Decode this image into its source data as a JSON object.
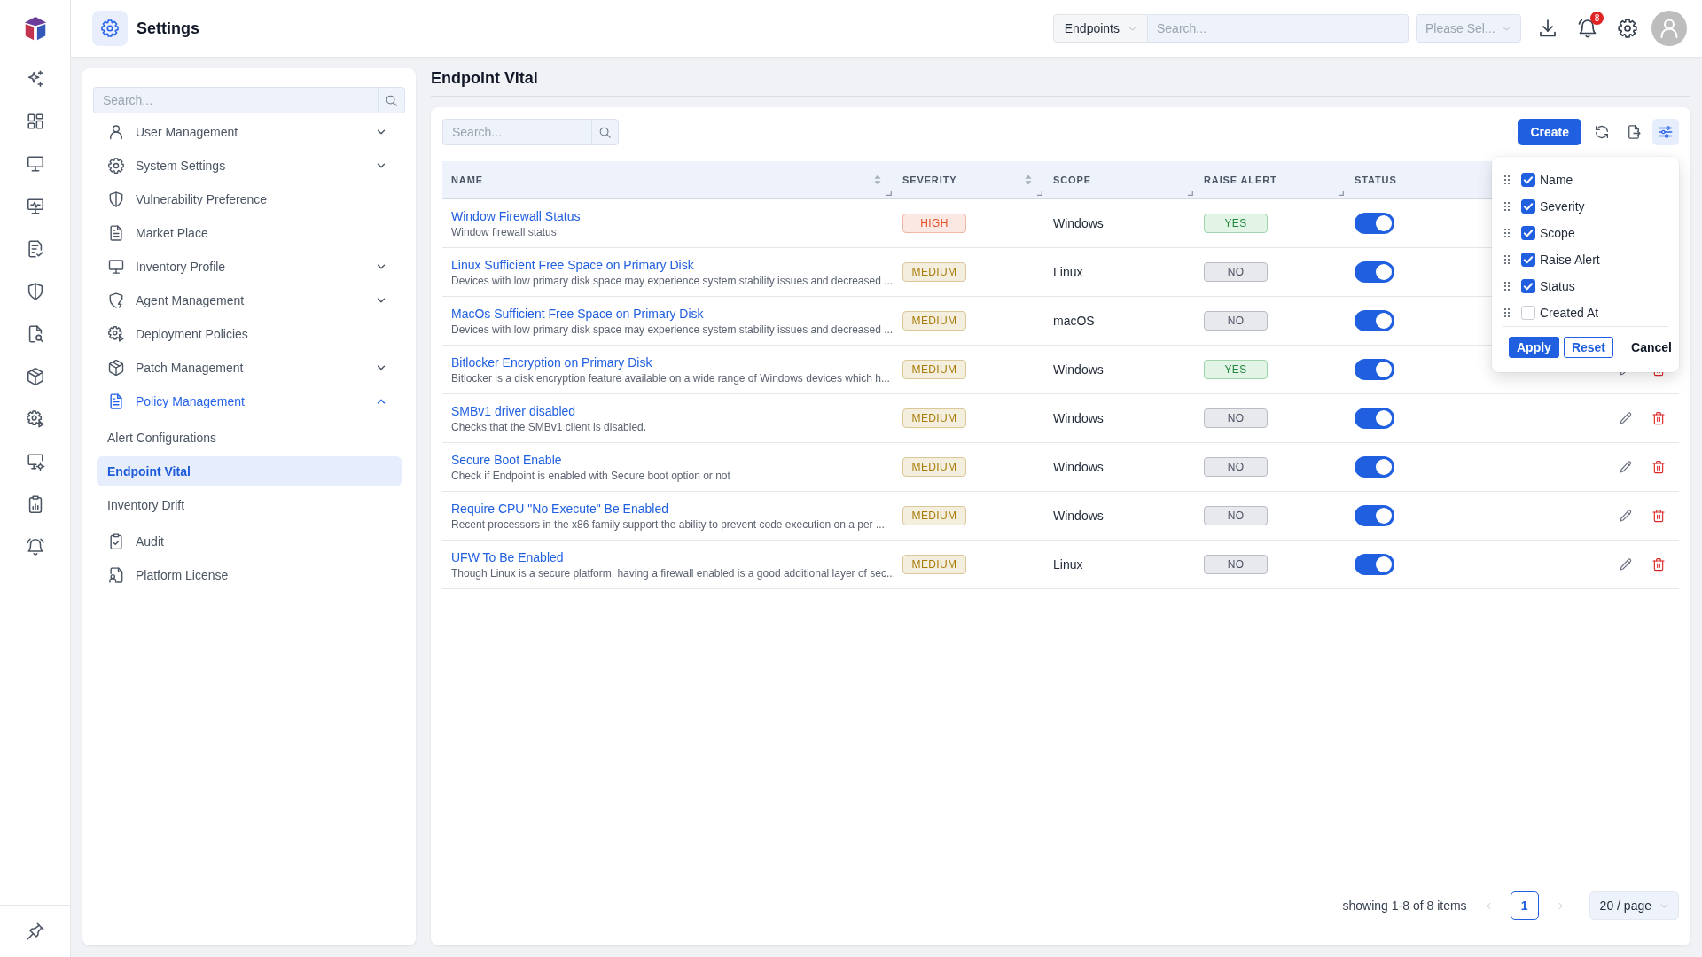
{
  "topbar": {
    "title": "Settings",
    "scope_select": {
      "value": "Endpoints"
    },
    "search": {
      "placeholder": "Search..."
    },
    "filter_select": {
      "placeholder": "Please Sel..."
    },
    "notification_count": "8"
  },
  "sidebar": {
    "search": {
      "placeholder": "Search..."
    },
    "items": [
      {
        "label": "User Management",
        "kind": "group",
        "expanded": false,
        "selected": false
      },
      {
        "label": "System Settings",
        "kind": "group",
        "expanded": false,
        "selected": false
      },
      {
        "label": "Vulnerability Preference",
        "kind": "link",
        "selected": false
      },
      {
        "label": "Market Place",
        "kind": "link",
        "selected": false
      },
      {
        "label": "Inventory Profile",
        "kind": "group",
        "expanded": false,
        "selected": false
      },
      {
        "label": "Agent Management",
        "kind": "group",
        "expanded": false,
        "selected": false
      },
      {
        "label": "Deployment Policies",
        "kind": "link",
        "selected": false
      },
      {
        "label": "Patch Management",
        "kind": "group",
        "expanded": false,
        "selected": false
      },
      {
        "label": "Policy Management",
        "kind": "group",
        "expanded": true,
        "selected": false,
        "children": [
          {
            "label": "Alert Configurations",
            "selected": false
          },
          {
            "label": "Endpoint Vital",
            "selected": true
          },
          {
            "label": "Inventory Drift",
            "selected": false
          }
        ]
      },
      {
        "label": "Audit",
        "kind": "link",
        "selected": false
      },
      {
        "label": "Platform License",
        "kind": "link",
        "selected": false
      }
    ]
  },
  "page": {
    "title": "Endpoint Vital",
    "toolbar": {
      "search": {
        "placeholder": "Search..."
      },
      "create_button": "Create",
      "column_menu": {
        "open": true,
        "items": [
          {
            "label": "Name",
            "checked": true
          },
          {
            "label": "Severity",
            "checked": true
          },
          {
            "label": "Scope",
            "checked": true
          },
          {
            "label": "Raise Alert",
            "checked": true
          },
          {
            "label": "Status",
            "checked": true
          },
          {
            "label": "Created At",
            "checked": false
          }
        ],
        "buttons": [
          {
            "label": "Apply",
            "kind": "primary"
          },
          {
            "label": "Reset",
            "kind": "outline"
          },
          {
            "label": "Cancel",
            "kind": "text"
          }
        ]
      }
    },
    "table": {
      "columns": [
        {
          "label": "NAME",
          "sortable": true,
          "resizable": true
        },
        {
          "label": "SEVERITY",
          "sortable": true,
          "resizable": true
        },
        {
          "label": "SCOPE",
          "sortable": false,
          "resizable": true
        },
        {
          "label": "RAISE ALERT",
          "sortable": false,
          "resizable": true
        },
        {
          "label": "STATUS",
          "sortable": false,
          "resizable": false
        }
      ],
      "rows": [
        {
          "name": "Window Firewall Status",
          "description": "Window firewall status",
          "severity": {
            "label": "HIGH",
            "color": "#e0512b"
          },
          "scope": "Windows",
          "raise_alert": {
            "label": "YES",
            "on": true
          },
          "enabled": true
        },
        {
          "name": "Linux Sufficient Free Space on Primary Disk",
          "description": "Devices with low primary disk space may experience system stability issues and decreased ...",
          "severity": {
            "label": "MEDIUM",
            "color": "#a87b06"
          },
          "scope": "Linux",
          "raise_alert": {
            "label": "NO",
            "on": false
          },
          "enabled": true
        },
        {
          "name": "MacOs Sufficient Free Space on Primary Disk",
          "description": "Devices with low primary disk space may experience system stability issues and decreased ...",
          "severity": {
            "label": "MEDIUM",
            "color": "#a87b06"
          },
          "scope": "macOS",
          "raise_alert": {
            "label": "NO",
            "on": false
          },
          "enabled": true
        },
        {
          "name": "Bitlocker Encryption on Primary Disk",
          "description": "Bitlocker is a disk encryption feature available on a wide range of Windows devices which h...",
          "severity": {
            "label": "MEDIUM",
            "color": "#a87b06"
          },
          "scope": "Windows",
          "raise_alert": {
            "label": "YES",
            "on": true
          },
          "enabled": true
        },
        {
          "name": "SMBv1 driver disabled",
          "description": "Checks that the SMBv1 client is disabled.",
          "severity": {
            "label": "MEDIUM",
            "color": "#a87b06"
          },
          "scope": "Windows",
          "raise_alert": {
            "label": "NO",
            "on": false
          },
          "enabled": true
        },
        {
          "name": "Secure Boot Enable",
          "description": "Check if Endpoint is enabled with Secure boot option or not",
          "severity": {
            "label": "MEDIUM",
            "color": "#a87b06"
          },
          "scope": "Windows",
          "raise_alert": {
            "label": "NO",
            "on": false
          },
          "enabled": true
        },
        {
          "name": "Require CPU \"No Execute\" Be Enabled",
          "description": "Recent processors in the x86 family support the ability to prevent code execution on a per ...",
          "severity": {
            "label": "MEDIUM",
            "color": "#a87b06"
          },
          "scope": "Windows",
          "raise_alert": {
            "label": "NO",
            "on": false
          },
          "enabled": true
        },
        {
          "name": "UFW To Be Enabled",
          "description": "Though Linux is a secure platform, having a firewall enabled is a good additional layer of sec...",
          "severity": {
            "label": "MEDIUM",
            "color": "#a87b06"
          },
          "scope": "Linux",
          "raise_alert": {
            "label": "NO",
            "on": false
          },
          "enabled": true
        }
      ]
    },
    "pagination": {
      "summary": "showing 1-8 of 8 items",
      "prev_disabled": true,
      "pages": [
        {
          "label": "1",
          "selected": true
        }
      ],
      "next_disabled": true,
      "page_size": "20 / page"
    }
  }
}
